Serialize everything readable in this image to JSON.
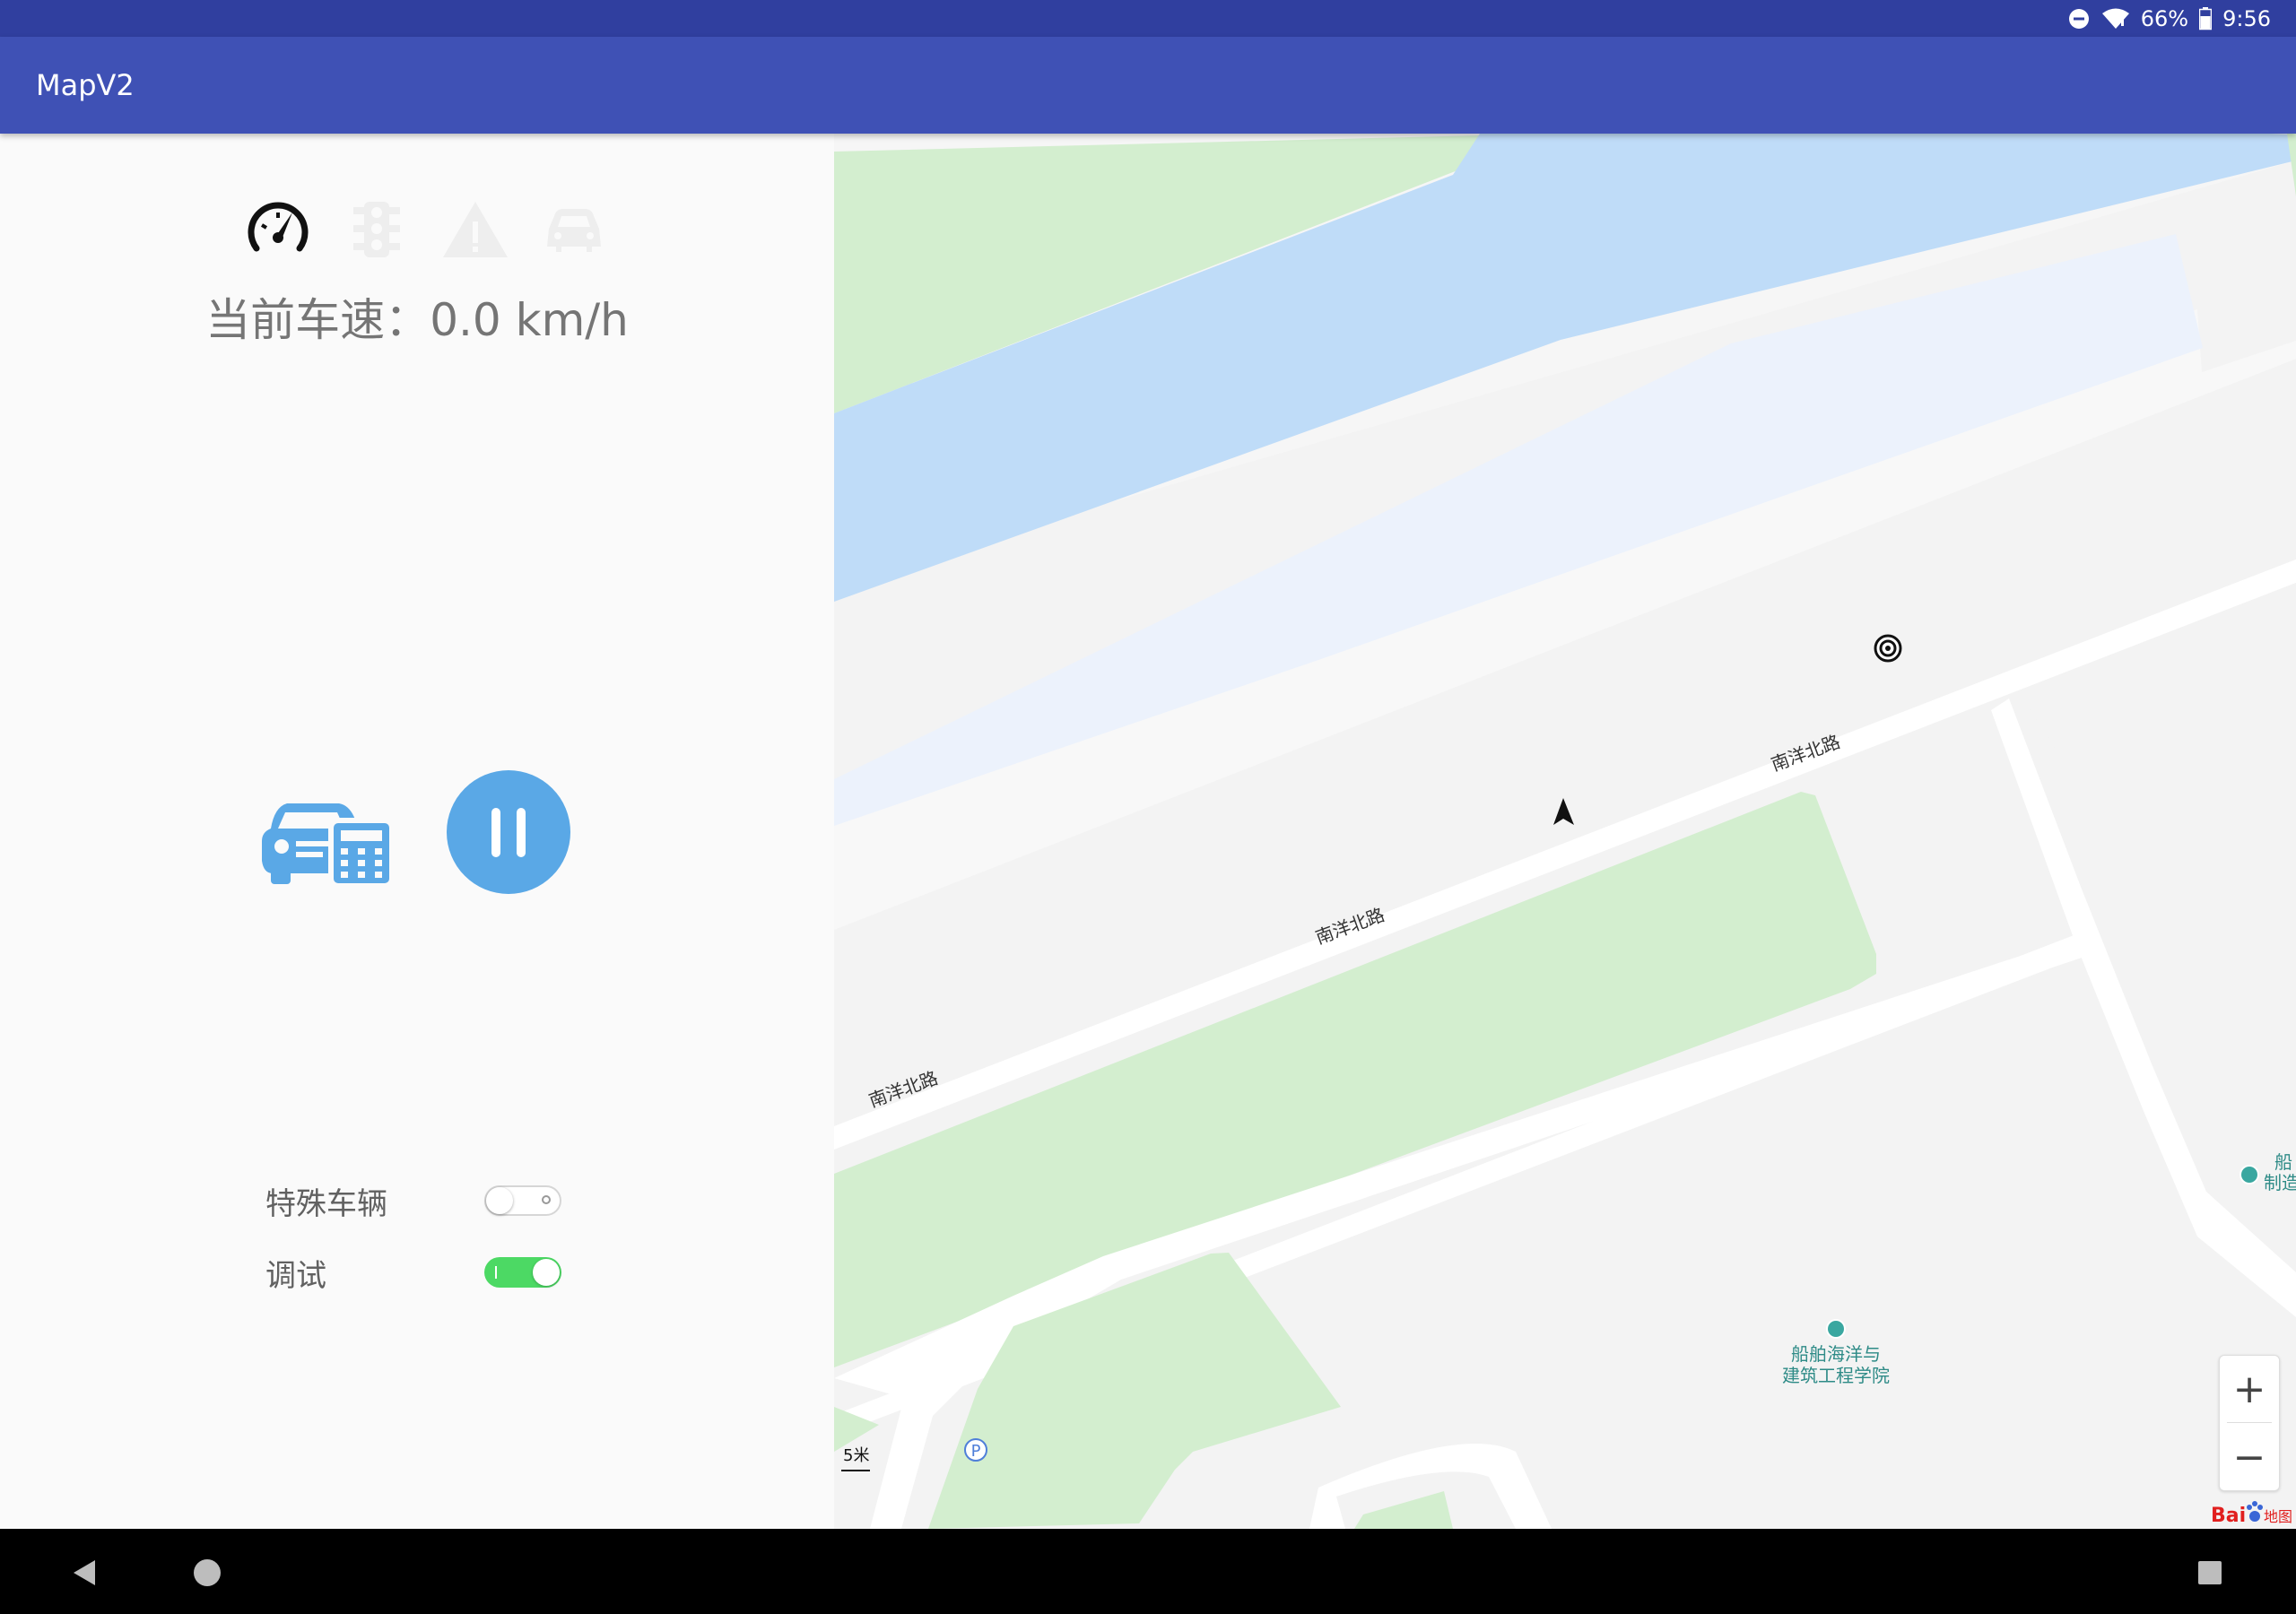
{
  "status": {
    "battery": "66%",
    "time": "9:56"
  },
  "app": {
    "title": "MapV2"
  },
  "panel": {
    "speed_label": "当前车速：",
    "speed_value": "0.0",
    "speed_unit": " km/h",
    "toggles": [
      {
        "label": "特殊车辆",
        "on": false
      },
      {
        "label": "调试",
        "on": true
      }
    ]
  },
  "map": {
    "roads": [
      "南洋北路",
      "南洋北路",
      "南洋北路"
    ],
    "poi_college_line1": "船舶海洋与",
    "poi_college_line2": "建筑工程学院",
    "poi_edge_line1": "船",
    "poi_edge_line2": "制造",
    "parking": "P",
    "scale": "5米",
    "brand": "Bai",
    "brand_suffix": "地图",
    "zoom_in": "+",
    "zoom_out": "−"
  },
  "colors": {
    "appbar": "#3f51b5",
    "statusbar": "#303f9f",
    "accent": "#5aa8e6",
    "switch_on": "#4cd964"
  }
}
